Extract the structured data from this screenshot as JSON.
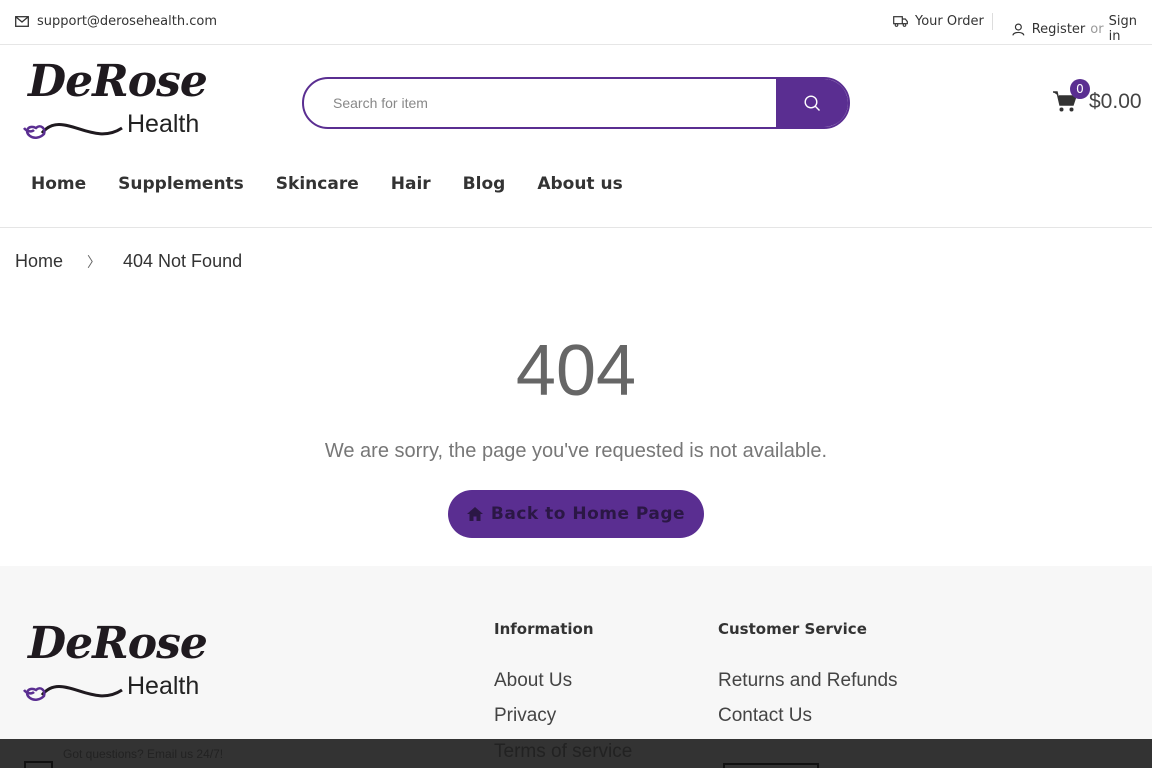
{
  "topbar": {
    "email": "support@derosehealth.com",
    "order_label": "Your Order",
    "register": "Register",
    "or": "or",
    "signin": "Sign in"
  },
  "logo": {
    "script": "DeRose",
    "health": "Health"
  },
  "search": {
    "placeholder": "Search for item"
  },
  "cart": {
    "count": "0",
    "total": "$0.00"
  },
  "nav": [
    "Home",
    "Supplements",
    "Skincare",
    "Hair",
    "Blog",
    "About us"
  ],
  "breadcrumb": {
    "home": "Home",
    "current": "404 Not Found"
  },
  "error": {
    "code": "404",
    "message": "We are sorry, the page you've requested is not available.",
    "button": "Back to Home Page"
  },
  "footer": {
    "info_title": "Information",
    "info_links": [
      "About Us",
      "Privacy",
      "Terms of service"
    ],
    "service_title": "Customer Service",
    "service_links": [
      "Returns and Refunds",
      "Contact Us"
    ],
    "questions": "Got questions? Email us 24/7!"
  },
  "colors": {
    "brand": "#5a2e91",
    "footer_bg": "#f7f7f7",
    "bottombar": "#333333"
  }
}
